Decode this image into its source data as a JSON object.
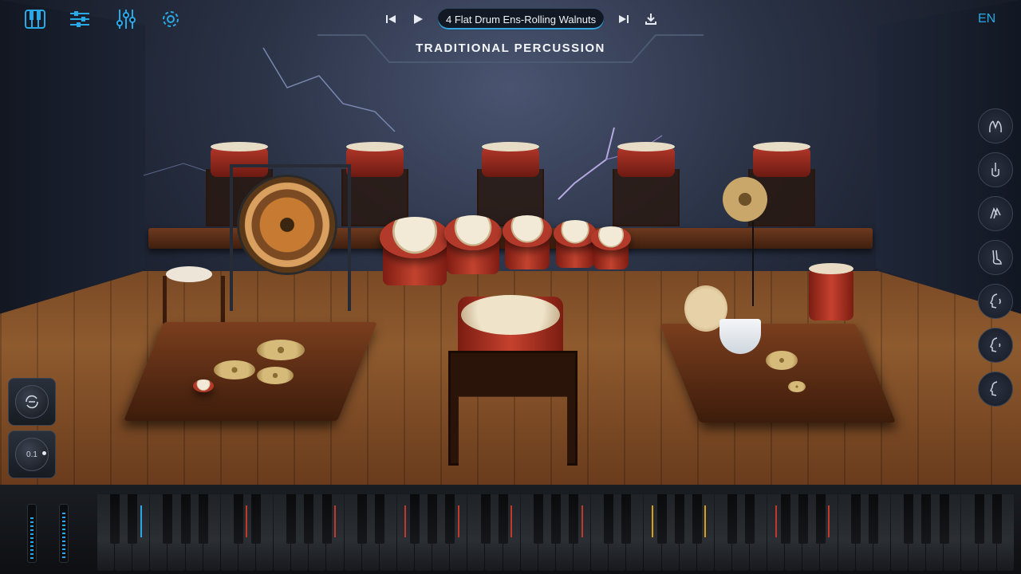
{
  "header": {
    "icons": [
      "piano-icon",
      "mixer-icon",
      "eq-icon",
      "gear-icon"
    ],
    "transport": {
      "prev": "⏮",
      "play": "▶",
      "next": "⏭",
      "download": "⤓"
    },
    "preset_name": "4 Flat Drum Ens-Rolling Walnuts",
    "title": "TRADITIONAL PERCUSSION",
    "language": "EN"
  },
  "side_buttons": [
    "hands-icon",
    "finger-icon",
    "clap-icon",
    "foot-icon",
    "voice-icon",
    "voice-2-icon",
    "voice-3-icon"
  ],
  "left_controls": {
    "knob_value": "0.1"
  },
  "colors": {
    "accent": "#29a9e6",
    "drum_red": "#b33a2b",
    "wood": "#7a4a26"
  },
  "keyboard": {
    "white_keys": 52,
    "sliders": 2
  }
}
